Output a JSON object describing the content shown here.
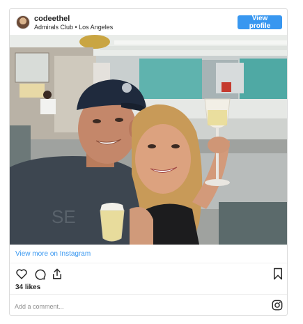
{
  "post": {
    "username": "codeethel",
    "location": "Admirals Club • Los Angeles",
    "view_profile_label": "View profile",
    "view_more_label": "View more on Instagram",
    "likes": "34 likes",
    "comment_placeholder": "Add a comment..."
  },
  "icons": {
    "like": "heart-icon",
    "comment": "speech-bubble-icon",
    "share": "share-icon",
    "save": "bookmark-icon",
    "brand": "instagram-logo-icon"
  },
  "colors": {
    "accent": "#3897f0",
    "text": "#262626",
    "muted": "#8e8e8e",
    "border": "#dbdbdb"
  }
}
